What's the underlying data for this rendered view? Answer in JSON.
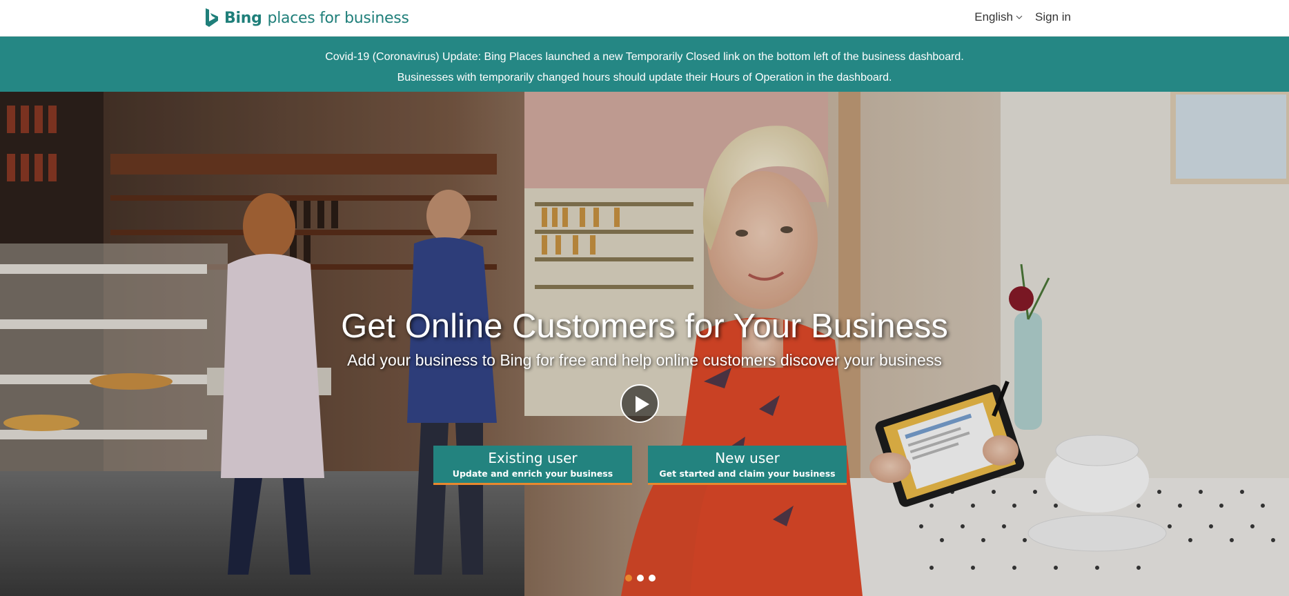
{
  "header": {
    "logo_brand": "Bing",
    "logo_tagline": "places for business",
    "language_label": "English",
    "signin_label": "Sign in"
  },
  "banner": {
    "line1": "Covid-19 (Coronavirus) Update: Bing Places launched a new Temporarily Closed link on the bottom left of the business dashboard.",
    "line2": "Businesses with temporarily changed hours should update their Hours of Operation in the dashboard."
  },
  "hero": {
    "title": "Get Online Customers for Your Business",
    "subtitle": "Add your business to Bing for free and help online customers discover your business",
    "existing_user": {
      "title": "Existing user",
      "subtitle": "Update and enrich your business"
    },
    "new_user": {
      "title": "New user",
      "subtitle": "Get started and claim your business"
    },
    "carousel": {
      "slides": 3,
      "active_slide": 1
    }
  },
  "colors": {
    "brand_teal": "#258784",
    "button_teal": "#23837f",
    "accent_orange": "#e8882e",
    "logo_teal": "#1f7f7a"
  }
}
